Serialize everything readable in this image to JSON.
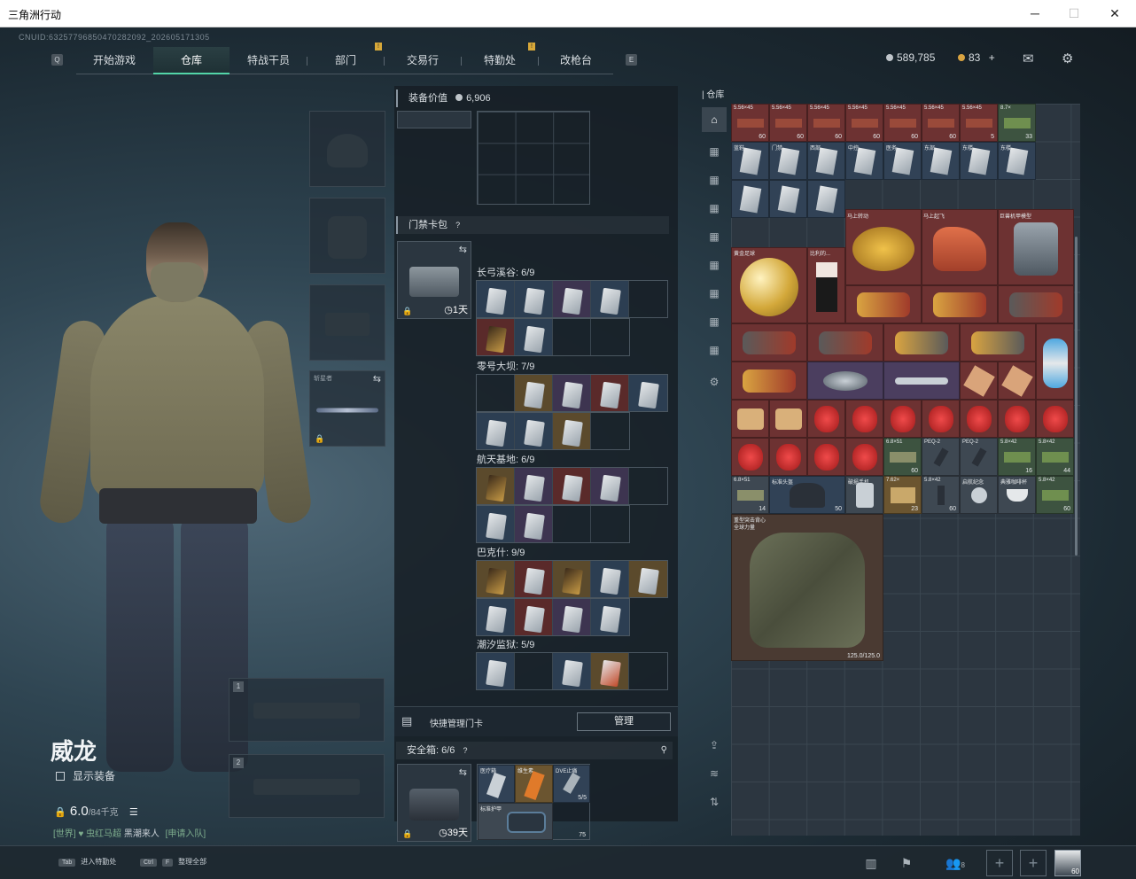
{
  "window": {
    "title": "三角洲行动",
    "minimize": "─",
    "maximize": "☐",
    "close": "✕"
  },
  "cnuid": "CNUID:63257796850470282092_202605171305",
  "nav": {
    "left_key": "Q",
    "right_key": "E",
    "tabs": [
      {
        "label": "开始游戏",
        "active": false
      },
      {
        "label": "仓库",
        "active": true
      },
      {
        "label": "特战干员",
        "active": false
      },
      {
        "label": "部门",
        "active": false
      },
      {
        "label": "交易行",
        "active": false
      },
      {
        "label": "特勤处",
        "active": false
      },
      {
        "label": "改枪台",
        "active": false
      }
    ]
  },
  "currency": {
    "coins": "589,785",
    "bonds": "83",
    "plus": "+"
  },
  "character": {
    "name": "威龙",
    "show_gear": "显示装备",
    "weight_value": "6.0",
    "weight_unit": "/84千克",
    "chat": {
      "channel": "[世界]",
      "player": "虫红马超",
      "message": "黑潮来人",
      "action": "[申请入队]"
    }
  },
  "equip": {
    "melee_label": "斩星者",
    "weapon_slot_1": "1",
    "weapon_slot_2": "2"
  },
  "middle": {
    "equip_value_label": "装备价值",
    "equip_value": "6,906",
    "keycard_header": "门禁卡包",
    "keycard_help": "?",
    "keycard_bag_time": "1天",
    "maps": [
      {
        "title": "长弓溪谷: 6/9"
      },
      {
        "title": "零号大坝: 7/9"
      },
      {
        "title": "航天基地: 6/9"
      },
      {
        "title": "巴克什: 9/9"
      },
      {
        "title": "潮汐监狱: 5/9"
      }
    ],
    "quick_manage": "快捷管理门卡",
    "manage_button": "管理",
    "safe_box_label": "安全箱: 6/6",
    "safe_box_help": "?",
    "safe_box_time": "39天",
    "safe_items": [
      {
        "label": "医疗箱"
      },
      {
        "label": "维生素"
      },
      {
        "label": "DVE止痛",
        "count": "5/5"
      },
      {
        "label": "标准护甲"
      },
      {
        "label": "",
        "count": "75"
      }
    ]
  },
  "stash": {
    "label": "仓库",
    "bottom_vest_label": "重型突击背心",
    "bottom_vest_sub": "全球力量",
    "vest_durability": "125.0/125.0",
    "row1": [
      {
        "label": "5.56×45",
        "count": "60"
      },
      {
        "label": "5.56×45",
        "count": "60"
      },
      {
        "label": "5.56×45",
        "count": "60"
      },
      {
        "label": "5.56×45",
        "count": "60"
      },
      {
        "label": "5.56×45",
        "count": "60"
      },
      {
        "label": "5.56×45",
        "count": "60"
      },
      {
        "label": "5.56×45",
        "count": "5"
      },
      {
        "label": "8.7×",
        "count": "33"
      }
    ],
    "row2_labels": [
      "蓝鞋",
      "门禁",
      "西部",
      "中控",
      "医务",
      "东部",
      "东楼",
      "东楼"
    ],
    "named_items": {
      "hat": "马上转动",
      "horse": "马上起飞",
      "robot": "巨兽机甲模型",
      "ball": "黄金足球",
      "doll": "比利的..."
    },
    "ammo_row": [
      {
        "label": "6.8×51",
        "count": "60"
      },
      {
        "label": "PEQ-2"
      },
      {
        "label": "PEQ-2"
      },
      {
        "label": "5.8×42",
        "count": "16"
      },
      {
        "label": "5.8×42",
        "count": "44"
      }
    ],
    "row_last": [
      {
        "label": "6.8×51",
        "count": "14"
      },
      {
        "label": "标准头盔",
        "count": "50"
      },
      {
        "label": "破损手机"
      },
      {
        "label": "7.62×",
        "count": "23"
      },
      {
        "label": "5.8×42",
        "count": "60"
      },
      {
        "label": "启航纪念"
      },
      {
        "label": "典雅咖啡杯"
      },
      {
        "label": "5.8×42",
        "count": "60"
      }
    ]
  },
  "bottom": {
    "hint1_key": "Tab",
    "hint1_text": "进入特勤处",
    "hint2_key1": "Ctrl",
    "hint2_key2": "F",
    "hint2_text": "整理全部",
    "team_count": "8",
    "level": "60"
  }
}
